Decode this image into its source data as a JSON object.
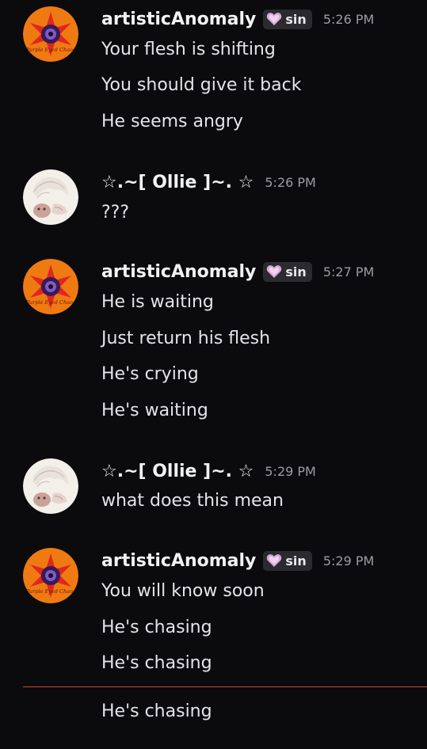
{
  "messages": [
    {
      "author": "artisticAnomaly",
      "tag": "sin",
      "time": "5:26 PM",
      "lines": [
        "Your flesh is shifting",
        "You should give it back",
        "He seems angry"
      ]
    },
    {
      "author": "☆.~[ Ollie ]~. ☆",
      "time": "5:26 PM",
      "lines": [
        "???"
      ]
    },
    {
      "author": "artisticAnomaly",
      "tag": "sin",
      "time": "5:27 PM",
      "lines": [
        "He is waiting",
        "Just return his flesh",
        "He's crying",
        "He's waiting"
      ]
    },
    {
      "author": "☆.~[ Ollie ]~. ☆",
      "time": "5:29 PM",
      "lines": [
        "what does this mean"
      ]
    },
    {
      "author": "artisticAnomaly",
      "tag": "sin",
      "time": "5:29 PM",
      "lines": [
        "You will know soon",
        "He's chasing",
        "He's chasing"
      ]
    }
  ],
  "new_messages": {
    "lines": [
      "He's chasing"
    ]
  },
  "avatar_text": {
    "artistic": "Purple Eyed Chaos"
  },
  "colors": {
    "background": "#0b0b0d",
    "new_message_divider": "#d83c3e",
    "avatar_orange": "#f07a12",
    "avatar_star_red": "#e0271f",
    "tag_background": "#2a2a2f"
  },
  "icons": {
    "artistic_avatar": "red-star-purple-eye-avatar",
    "ollie_avatar": "sketch-character-avatar",
    "tag_icon": "pink-heart-icon"
  }
}
